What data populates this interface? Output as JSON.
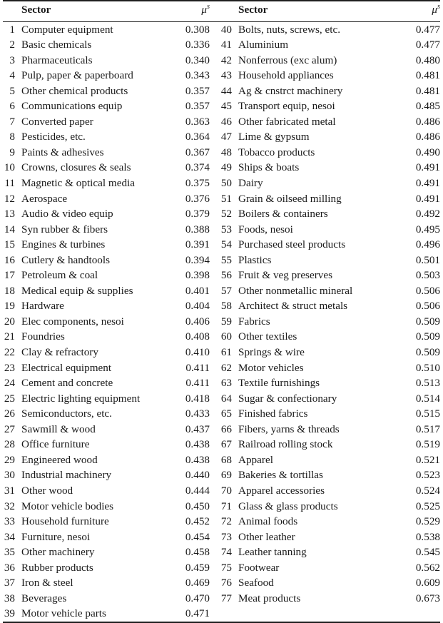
{
  "table": {
    "headers": {
      "index_label": "",
      "sector_label": "Sector",
      "value_symbol": "μ",
      "value_superscript": "s"
    },
    "left_column": [
      {
        "index": "1",
        "sector": "Computer equipment",
        "value": "0.308"
      },
      {
        "index": "2",
        "sector": "Basic chemicals",
        "value": "0.336"
      },
      {
        "index": "3",
        "sector": "Pharmaceuticals",
        "value": "0.340"
      },
      {
        "index": "4",
        "sector": "Pulp, paper & paperboard",
        "value": "0.343"
      },
      {
        "index": "5",
        "sector": "Other chemical products",
        "value": "0.357"
      },
      {
        "index": "6",
        "sector": "Communications equip",
        "value": "0.357"
      },
      {
        "index": "7",
        "sector": "Converted paper",
        "value": "0.363"
      },
      {
        "index": "8",
        "sector": "Pesticides, etc.",
        "value": "0.364"
      },
      {
        "index": "9",
        "sector": "Paints & adhesives",
        "value": "0.367"
      },
      {
        "index": "10",
        "sector": "Crowns, closures & seals",
        "value": "0.374"
      },
      {
        "index": "11",
        "sector": "Magnetic & optical media",
        "value": "0.375"
      },
      {
        "index": "12",
        "sector": "Aerospace",
        "value": "0.376"
      },
      {
        "index": "13",
        "sector": "Audio & video equip",
        "value": "0.379"
      },
      {
        "index": "14",
        "sector": "Syn rubber & fibers",
        "value": "0.388"
      },
      {
        "index": "15",
        "sector": "Engines & turbines",
        "value": "0.391"
      },
      {
        "index": "16",
        "sector": "Cutlery & handtools",
        "value": "0.394"
      },
      {
        "index": "17",
        "sector": "Petroleum & coal",
        "value": "0.398"
      },
      {
        "index": "18",
        "sector": "Medical equip & supplies",
        "value": "0.401"
      },
      {
        "index": "19",
        "sector": "Hardware",
        "value": "0.404"
      },
      {
        "index": "20",
        "sector": "Elec components, nesoi",
        "value": "0.406"
      },
      {
        "index": "21",
        "sector": "Foundries",
        "value": "0.408"
      },
      {
        "index": "22",
        "sector": "Clay & refractory",
        "value": "0.410"
      },
      {
        "index": "23",
        "sector": "Electrical equipment",
        "value": "0.411"
      },
      {
        "index": "24",
        "sector": "Cement and concrete",
        "value": "0.411"
      },
      {
        "index": "25",
        "sector": "Electric lighting equipment",
        "value": "0.418"
      },
      {
        "index": "26",
        "sector": "Semiconductors, etc.",
        "value": "0.433"
      },
      {
        "index": "27",
        "sector": "Sawmill & wood",
        "value": "0.437"
      },
      {
        "index": "28",
        "sector": "Office furniture",
        "value": "0.438"
      },
      {
        "index": "29",
        "sector": "Engineered wood",
        "value": "0.438"
      },
      {
        "index": "30",
        "sector": "Industrial machinery",
        "value": "0.440"
      },
      {
        "index": "31",
        "sector": "Other wood",
        "value": "0.444"
      },
      {
        "index": "32",
        "sector": "Motor vehicle bodies",
        "value": "0.450"
      },
      {
        "index": "33",
        "sector": "Household furniture",
        "value": "0.452"
      },
      {
        "index": "34",
        "sector": "Furniture, nesoi",
        "value": "0.454"
      },
      {
        "index": "35",
        "sector": "Other machinery",
        "value": "0.458"
      },
      {
        "index": "36",
        "sector": "Rubber products",
        "value": "0.459"
      },
      {
        "index": "37",
        "sector": "Iron & steel",
        "value": "0.469"
      },
      {
        "index": "38",
        "sector": "Beverages",
        "value": "0.470"
      },
      {
        "index": "39",
        "sector": "Motor vehicle parts",
        "value": "0.471"
      }
    ],
    "right_column": [
      {
        "index": "40",
        "sector": "Bolts, nuts, screws, etc.",
        "value": "0.477"
      },
      {
        "index": "41",
        "sector": "Aluminium",
        "value": "0.477"
      },
      {
        "index": "42",
        "sector": "Nonferrous (exc alum)",
        "value": "0.480"
      },
      {
        "index": "43",
        "sector": "Household appliances",
        "value": "0.481"
      },
      {
        "index": "44",
        "sector": "Ag & cnstrct machinery",
        "value": "0.481"
      },
      {
        "index": "45",
        "sector": "Transport equip, nesoi",
        "value": "0.485"
      },
      {
        "index": "46",
        "sector": "Other fabricated metal",
        "value": "0.486"
      },
      {
        "index": "47",
        "sector": "Lime & gypsum",
        "value": "0.486"
      },
      {
        "index": "48",
        "sector": "Tobacco products",
        "value": "0.490"
      },
      {
        "index": "49",
        "sector": "Ships & boats",
        "value": "0.491"
      },
      {
        "index": "50",
        "sector": "Dairy",
        "value": "0.491"
      },
      {
        "index": "51",
        "sector": "Grain & oilseed milling",
        "value": "0.491"
      },
      {
        "index": "52",
        "sector": "Boilers & containers",
        "value": "0.492"
      },
      {
        "index": "53",
        "sector": "Foods, nesoi",
        "value": "0.495"
      },
      {
        "index": "54",
        "sector": "Purchased steel products",
        "value": "0.496"
      },
      {
        "index": "55",
        "sector": "Plastics",
        "value": "0.501"
      },
      {
        "index": "56",
        "sector": "Fruit & veg preserves",
        "value": "0.503"
      },
      {
        "index": "57",
        "sector": "Other nonmetallic mineral",
        "value": "0.506"
      },
      {
        "index": "58",
        "sector": "Architect & struct metals",
        "value": "0.506"
      },
      {
        "index": "59",
        "sector": "Fabrics",
        "value": "0.509"
      },
      {
        "index": "60",
        "sector": "Other textiles",
        "value": "0.509"
      },
      {
        "index": "61",
        "sector": "Springs & wire",
        "value": "0.509"
      },
      {
        "index": "62",
        "sector": "Motor vehicles",
        "value": "0.510"
      },
      {
        "index": "63",
        "sector": "Textile furnishings",
        "value": "0.513"
      },
      {
        "index": "64",
        "sector": "Sugar & confectionary",
        "value": "0.514"
      },
      {
        "index": "65",
        "sector": "Finished fabrics",
        "value": "0.515"
      },
      {
        "index": "66",
        "sector": "Fibers, yarns & threads",
        "value": "0.517"
      },
      {
        "index": "67",
        "sector": "Railroad rolling stock",
        "value": "0.519"
      },
      {
        "index": "68",
        "sector": "Apparel",
        "value": "0.521"
      },
      {
        "index": "69",
        "sector": "Bakeries & tortillas",
        "value": "0.523"
      },
      {
        "index": "70",
        "sector": "Apparel accessories",
        "value": "0.524"
      },
      {
        "index": "71",
        "sector": "Glass & glass products",
        "value": "0.525"
      },
      {
        "index": "72",
        "sector": "Animal foods",
        "value": "0.529"
      },
      {
        "index": "73",
        "sector": "Other leather",
        "value": "0.538"
      },
      {
        "index": "74",
        "sector": "Leather tanning",
        "value": "0.545"
      },
      {
        "index": "75",
        "sector": "Footwear",
        "value": "0.562"
      },
      {
        "index": "76",
        "sector": "Seafood",
        "value": "0.609"
      },
      {
        "index": "77",
        "sector": "Meat products",
        "value": "0.673"
      },
      {
        "index": "",
        "sector": "",
        "value": ""
      }
    ]
  }
}
